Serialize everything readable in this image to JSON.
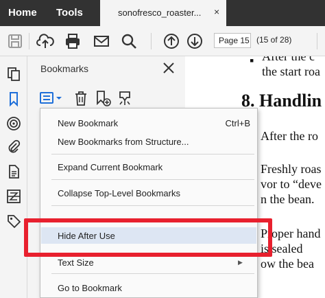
{
  "tabs": {
    "home": "Home",
    "tools": "Tools",
    "document": "sonofresco_roaster...",
    "close": "×"
  },
  "toolbar": {
    "page_value": "Page 15",
    "page_of": "(15 of 28)"
  },
  "bookmarks": {
    "title": "Bookmarks"
  },
  "menu": {
    "items": [
      {
        "label": "New Bookmark",
        "shortcut": "Ctrl+B"
      },
      {
        "label": "New Bookmarks from Structure..."
      },
      {
        "label": "Expand Current Bookmark"
      },
      {
        "label": "Collapse Top-Level Bookmarks"
      },
      {
        "label": "Hide After Use"
      },
      {
        "label": "Text Size"
      },
      {
        "label": "Go to Bookmark"
      }
    ]
  },
  "document": {
    "lines": [
      "After the c",
      "the start roa",
      "After the ro",
      "Freshly roas",
      "vor to “deve",
      "n the bean.",
      "Proper hand",
      "is sealed",
      "ow the bea"
    ],
    "heading": "8.  Handlin",
    "bullet": "▪"
  },
  "colors": {
    "highlight": "#e8202e",
    "tabbar": "#323232",
    "menu_hover": "#dde6f3"
  }
}
